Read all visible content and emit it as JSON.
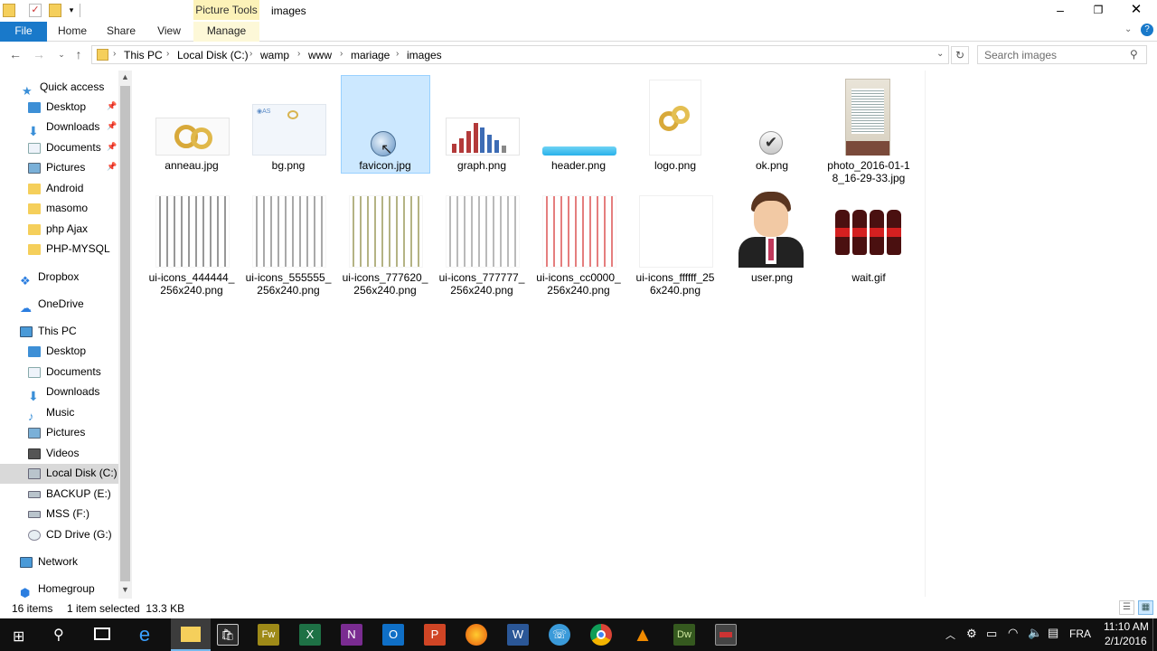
{
  "window": {
    "title": "images",
    "context_tab": "Picture Tools"
  },
  "ribbon": {
    "tabs": [
      "File",
      "Home",
      "Share",
      "View",
      "Manage"
    ]
  },
  "address": {
    "crumbs": [
      "This PC",
      "Local Disk (C:)",
      "wamp",
      "www",
      "mariage",
      "images"
    ],
    "search_placeholder": "Search images"
  },
  "sidebar": {
    "quick_access": "Quick access",
    "quick_items": [
      "Desktop",
      "Downloads",
      "Documents",
      "Pictures",
      "Android",
      "masomo",
      "php Ajax",
      "PHP-MYSQL"
    ],
    "dropbox": "Dropbox",
    "onedrive": "OneDrive",
    "thispc": "This PC",
    "pc_items": [
      "Desktop",
      "Documents",
      "Downloads",
      "Music",
      "Pictures",
      "Videos",
      "Local Disk (C:)",
      "BACKUP (E:)",
      "MSS (F:)",
      "CD Drive (G:)"
    ],
    "network": "Network",
    "homegroup": "Homegroup"
  },
  "files": [
    {
      "name": "anneau.jpg"
    },
    {
      "name": "bg.png"
    },
    {
      "name": "favicon.jpg",
      "selected": true
    },
    {
      "name": "graph.png"
    },
    {
      "name": "header.png"
    },
    {
      "name": "logo.png"
    },
    {
      "name": "ok.png"
    },
    {
      "name": "photo_2016-01-18_16-29-33.jpg",
      "label1": "photo_2016-01-1",
      "label2": "8_16-29-33.jpg"
    },
    {
      "name": "ui-icons_444444_256x240.png",
      "label1": "ui-icons_444444_",
      "label2": "256x240.png"
    },
    {
      "name": "ui-icons_555555_256x240.png",
      "label1": "ui-icons_555555_",
      "label2": "256x240.png"
    },
    {
      "name": "ui-icons_777620_256x240.png",
      "label1": "ui-icons_777620_",
      "label2": "256x240.png"
    },
    {
      "name": "ui-icons_777777_256x240.png",
      "label1": "ui-icons_777777_",
      "label2": "256x240.png"
    },
    {
      "name": "ui-icons_cc0000_256x240.png",
      "label1": "ui-icons_cc0000_",
      "label2": "256x240.png"
    },
    {
      "name": "ui-icons_ffffff_256x240.png",
      "label1": "ui-icons_ffffff_25",
      "label2": "6x240.png"
    },
    {
      "name": "user.png"
    },
    {
      "name": "wait.gif"
    }
  ],
  "status": {
    "count": "16 items",
    "selection": "1 item selected  13.3 KB"
  },
  "taskbar": {
    "lang": "FRA",
    "time": "11:10 AM",
    "date": "2/1/2016"
  },
  "colors": {
    "accent": "#1979ca",
    "selection": "#cce8ff",
    "taskbar": "#101010"
  }
}
